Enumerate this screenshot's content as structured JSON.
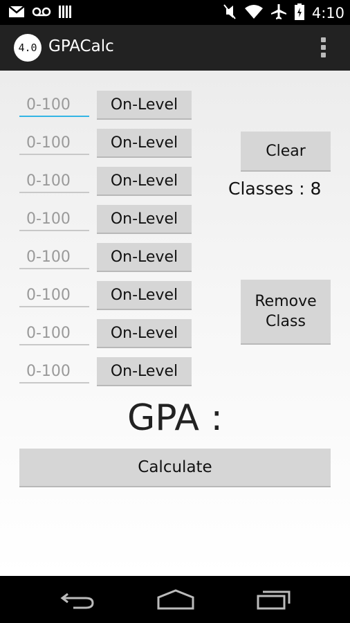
{
  "status_bar": {
    "time": "4:10",
    "icons": [
      "gmail-icon",
      "voicemail-icon",
      "signal-bars-icon",
      "mute-icon",
      "wifi-icon",
      "airplane-icon",
      "battery-icon"
    ]
  },
  "app_bar": {
    "logo_text": "4.0",
    "title": "GPACalc"
  },
  "grades": [
    {
      "placeholder": "0-100",
      "value": "",
      "level": "On-Level"
    },
    {
      "placeholder": "0-100",
      "value": "",
      "level": "On-Level"
    },
    {
      "placeholder": "0-100",
      "value": "",
      "level": "On-Level"
    },
    {
      "placeholder": "0-100",
      "value": "",
      "level": "On-Level"
    },
    {
      "placeholder": "0-100",
      "value": "",
      "level": "On-Level"
    },
    {
      "placeholder": "0-100",
      "value": "",
      "level": "On-Level"
    },
    {
      "placeholder": "0-100",
      "value": "",
      "level": "On-Level"
    },
    {
      "placeholder": "0-100",
      "value": "",
      "level": "On-Level"
    }
  ],
  "actions": {
    "clear_label": "Clear",
    "classes_count": "Classes : 8",
    "remove_line1": "Remove",
    "remove_line2": "Class"
  },
  "result": {
    "gpa_label": "GPA :"
  },
  "calculate_label": "Calculate",
  "colors": {
    "focus_accent": "#33b5e5",
    "button_bg": "#d6d6d6",
    "action_bar_bg": "#222222"
  },
  "nav_bar": {
    "icons": [
      "back-icon",
      "home-icon",
      "recent-apps-icon"
    ]
  }
}
